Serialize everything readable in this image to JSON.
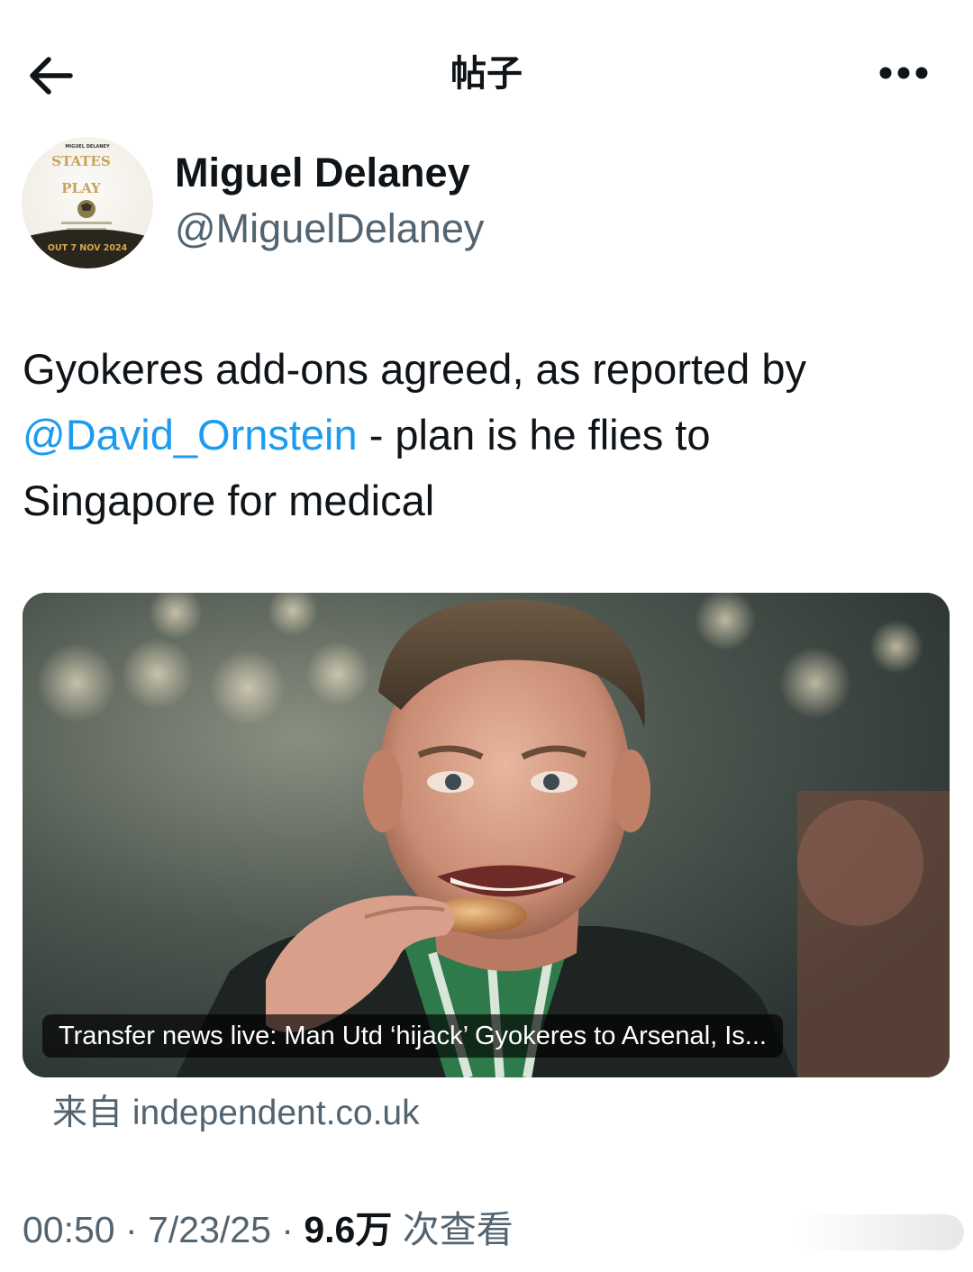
{
  "header": {
    "title": "帖子",
    "back_icon": "arrow-left-icon",
    "more_icon": "more-horizontal-icon"
  },
  "author": {
    "name": "Miguel Delaney",
    "handle": "@MiguelDelaney",
    "avatar": {
      "top_text": "MIGUEL DELANEY",
      "title_line1": "STATES",
      "title_line2": "PLAY",
      "bottom_text": "OUT 7 NOV 2024"
    }
  },
  "tweet": {
    "line1": "Gyokeres add-ons agreed, as reported by",
    "mention": "@David_Ornstein",
    "line2_rest": " - plan is he flies to",
    "line3": "Singapore for medical"
  },
  "card": {
    "caption": "Transfer news live: Man Utd ‘hijack’ Gyokeres to Arsenal, Is...",
    "source_prefix": "来自",
    "source_domain": "independent.co.uk"
  },
  "meta": {
    "time": "00:50",
    "separator": "·",
    "date": "7/23/25",
    "views": "9.6万",
    "views_label": "次查看"
  },
  "colors": {
    "text": "#0f1419",
    "secondary": "#536471",
    "link": "#1d9bf0"
  }
}
